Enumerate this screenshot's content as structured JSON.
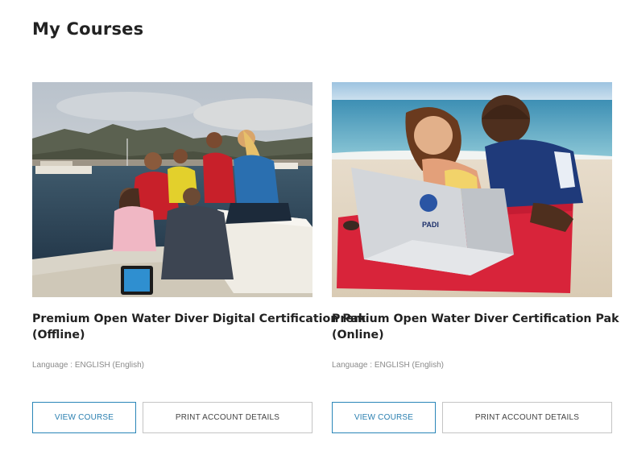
{
  "page": {
    "title": "My Courses"
  },
  "courses": [
    {
      "title_line1": "Premium Open Water Diver Digital Certification Pak",
      "title_line2": "(Offline)",
      "language": "Language : ENGLISH (English)",
      "view_label": "VIEW COURSE",
      "print_label": "PRINT ACCOUNT DETAILS",
      "image_alt": "Group of divers on a boat in a harbor"
    },
    {
      "title_line1": "Premium Open Water Diver Certification Pak",
      "title_line2": "(Online)",
      "language": "Language : ENGLISH (English)",
      "view_label": "VIEW COURSE",
      "print_label": "PRINT ACCOUNT DETAILS",
      "image_alt": "Two people on a beach towel using a laptop",
      "laptop_logo_text": "PADI"
    }
  ],
  "colors": {
    "accent": "#2a86b8",
    "title": "#222222",
    "muted": "#8a8a8a",
    "border": "#c4c4c4"
  }
}
